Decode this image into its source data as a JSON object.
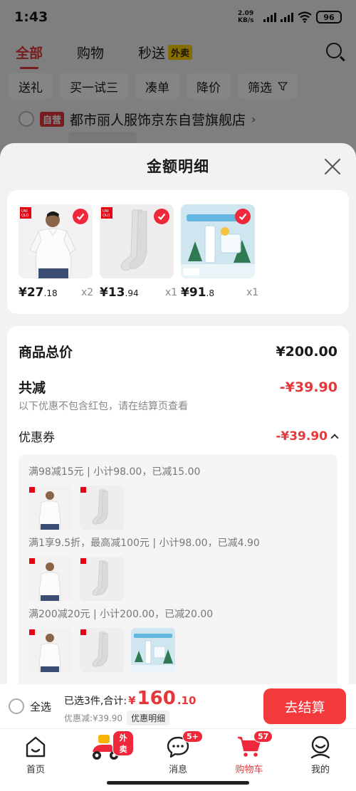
{
  "status_bar": {
    "time": "1:43",
    "net_speed": "2.09 KB/s",
    "battery": "96"
  },
  "top_tabs": [
    {
      "label": "全部"
    },
    {
      "label": "购物"
    },
    {
      "label": "秒送",
      "badge": "外卖"
    }
  ],
  "filters": [
    "送礼",
    "买一试三",
    "凑单",
    "降价",
    "筛选"
  ],
  "shop": {
    "tag": "自营",
    "name": "都市丽人服饰京东自营旗舰店"
  },
  "sheet": {
    "title": "金额明细"
  },
  "products": [
    {
      "price_int": "¥27",
      "price_dec": ".18",
      "qty": "x2",
      "kind": "tshirt"
    },
    {
      "price_int": "¥13",
      "price_dec": ".94",
      "qty": "x1",
      "kind": "socks"
    },
    {
      "price_int": "¥91",
      "price_dec": ".8",
      "qty": "x1",
      "kind": "cream"
    }
  ],
  "detail": {
    "total_label": "商品总价",
    "total_value": "¥200.00",
    "reduce_label": "共减",
    "reduce_value": "-¥39.90",
    "reduce_note": "以下优惠不包含红包，请在结算页查看",
    "coupon_label": "优惠券",
    "coupon_value": "-¥39.90",
    "coupons": [
      {
        "text": "满98减15元 | 小计98.00，已减15.00",
        "items": [
          "tshirt",
          "socks"
        ]
      },
      {
        "text": "满1享9.5折，最高减100元 | 小计98.00，已减4.90",
        "items": [
          "tshirt",
          "socks"
        ]
      },
      {
        "text": "满200减20元 | 小计200.00，已减20.00",
        "items": [
          "tshirt",
          "socks",
          "cream"
        ]
      }
    ]
  },
  "checkout": {
    "select_all": "全选",
    "selected_text": "已选3件,合计:",
    "currency": "¥",
    "total_int": "160",
    "total_dec": ".10",
    "discount_text": "优惠减:¥39.90",
    "detail_link": "优惠明细",
    "button": "去结算"
  },
  "bottom_nav": [
    {
      "label": "首页",
      "icon": "home-icon"
    },
    {
      "label": "",
      "icon": "delivery-scooter-icon",
      "badge": "外卖"
    },
    {
      "label": "消息",
      "icon": "message-icon",
      "badge": "5+"
    },
    {
      "label": "购物车",
      "icon": "cart-icon",
      "badge": "57",
      "active": true
    },
    {
      "label": "我的",
      "icon": "profile-icon"
    }
  ],
  "colors": {
    "accent": "#e4393c",
    "button": "#f23a3c",
    "takeout_badge": "#ffd200"
  }
}
